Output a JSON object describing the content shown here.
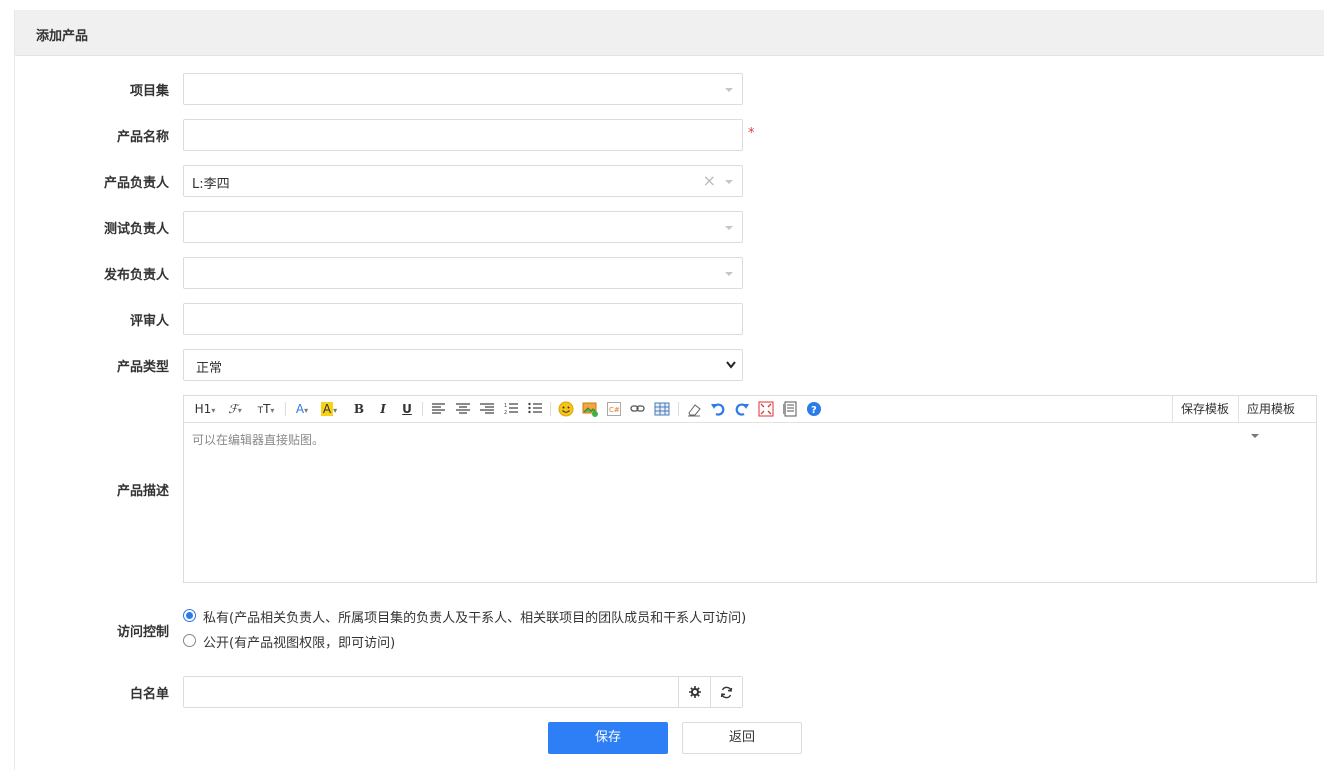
{
  "header": {
    "title": "添加产品"
  },
  "form": {
    "program": {
      "label": "项目集",
      "value": ""
    },
    "name": {
      "label": "产品名称",
      "value": "",
      "required_mark": "*"
    },
    "po": {
      "label": "产品负责人",
      "value": "L:李四",
      "clear_icon": "×"
    },
    "qd": {
      "label": "测试负责人",
      "value": ""
    },
    "rd": {
      "label": "发布负责人",
      "value": ""
    },
    "reviewer": {
      "label": "评审人",
      "value": ""
    },
    "type": {
      "label": "产品类型",
      "value": "正常",
      "options": [
        "正常"
      ]
    },
    "desc": {
      "label": "产品描述",
      "placeholder": "可以在编辑器直接贴图。",
      "toolbar": {
        "heading": "H1",
        "save_template": "保存模板",
        "apply_template": "应用模板"
      }
    },
    "acl": {
      "label": "访问控制",
      "options": [
        {
          "text": "私有(产品相关负责人、所属项目集的负责人及干系人、相关联项目的团队成员和干系人可访问)",
          "checked": true
        },
        {
          "text": "公开(有产品视图权限，即可访问)",
          "checked": false
        }
      ]
    },
    "whitelist": {
      "label": "白名单",
      "value": ""
    }
  },
  "actions": {
    "save": "保存",
    "back": "返回"
  },
  "colors": {
    "primary": "#2e7ff6",
    "required": "#e03c3c",
    "header_bg": "#f0f0f0"
  }
}
